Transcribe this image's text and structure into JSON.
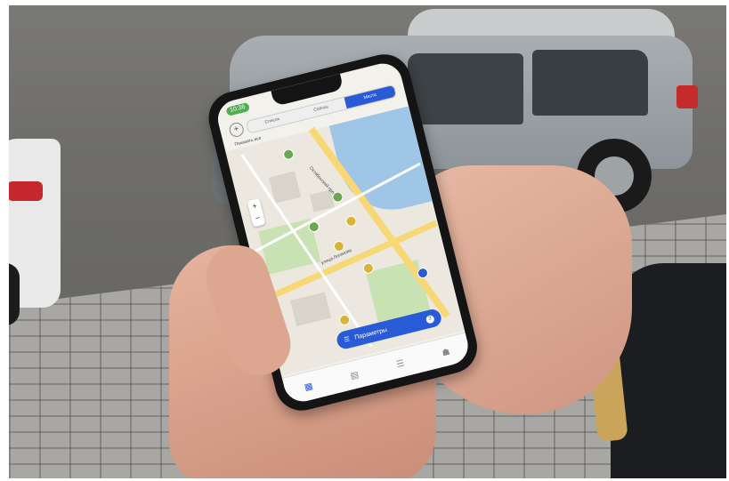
{
  "scene": {
    "subject": "hands holding smartphone showing map app in parking lot"
  },
  "phone": {
    "status": {
      "time": "10:36"
    },
    "tabs": {
      "add_symbol": "+",
      "segments": [
        "Список",
        "Сейчас",
        "Места"
      ],
      "active_index": 2
    },
    "subtitle": "Показать все",
    "map": {
      "streets": [
        "Октябрьский проспект",
        "улица Логинова"
      ],
      "zoom_in": "+",
      "zoom_out": "−"
    },
    "params_button": {
      "label": "Параметры",
      "count": "3"
    },
    "bottom_nav": [
      "▦",
      "▤",
      "☰",
      "☗"
    ]
  },
  "colors": {
    "accent": "#2a5bd7",
    "pin_yellow": "#d9b43a",
    "pin_green": "#6aa84f"
  }
}
